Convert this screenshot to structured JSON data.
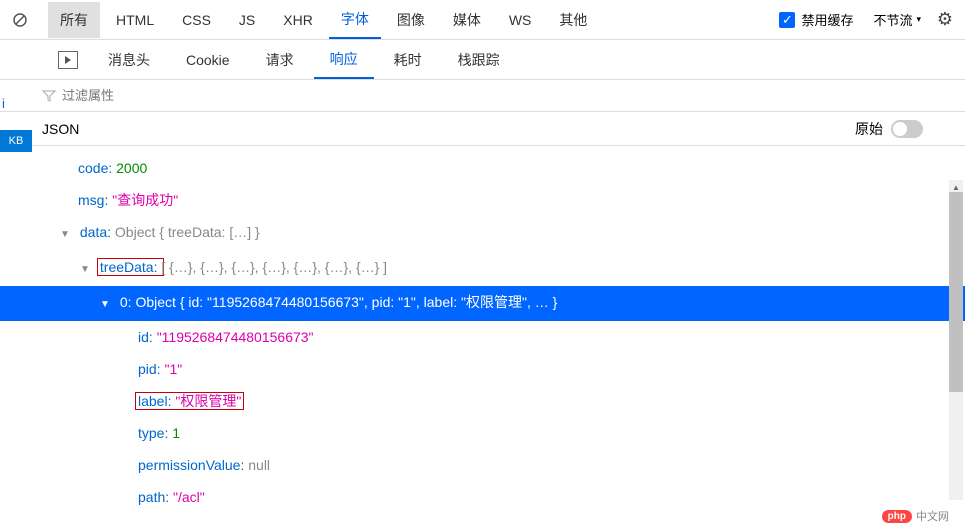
{
  "toolbar": {
    "filters": [
      "所有",
      "HTML",
      "CSS",
      "JS",
      "XHR",
      "字体",
      "图像",
      "媒体",
      "WS",
      "其他"
    ],
    "active_filter": "字体",
    "highlighted_filter": "所有",
    "disable_cache": "禁用缓存",
    "throttle": "不节流"
  },
  "subtabs": {
    "items": [
      "消息头",
      "Cookie",
      "请求",
      "响应",
      "耗时",
      "栈跟踪"
    ],
    "active": "响应"
  },
  "left_kb": "KB",
  "filter_placeholder": "过滤属性",
  "json_section": {
    "title": "JSON",
    "raw_label": "原始"
  },
  "tree": {
    "code_key": "code:",
    "code_val": "2000",
    "msg_key": "msg:",
    "msg_val": "\"查询成功\"",
    "data_key": "data:",
    "data_preview": "Object { treeData: […] }",
    "treedata_key": "treeData:",
    "treedata_preview": "[ {…}, {…}, {…}, {…}, {…}, {…}, {…} ]",
    "idx0_key": "0:",
    "idx0_preview": "Object { id: \"1195268474480156673\", pid: \"1\", label: \"权限管理\", … }",
    "id_key": "id:",
    "id_val": "\"1195268474480156673\"",
    "pid_key": "pid:",
    "pid_val": "\"1\"",
    "label_key": "label:",
    "label_val": "\"权限管理\"",
    "type_key": "type:",
    "type_val": "1",
    "permval_key": "permissionValue:",
    "permval_val": "null",
    "path_key": "path:",
    "path_val": "\"/acl\""
  },
  "watermark": "中文网"
}
